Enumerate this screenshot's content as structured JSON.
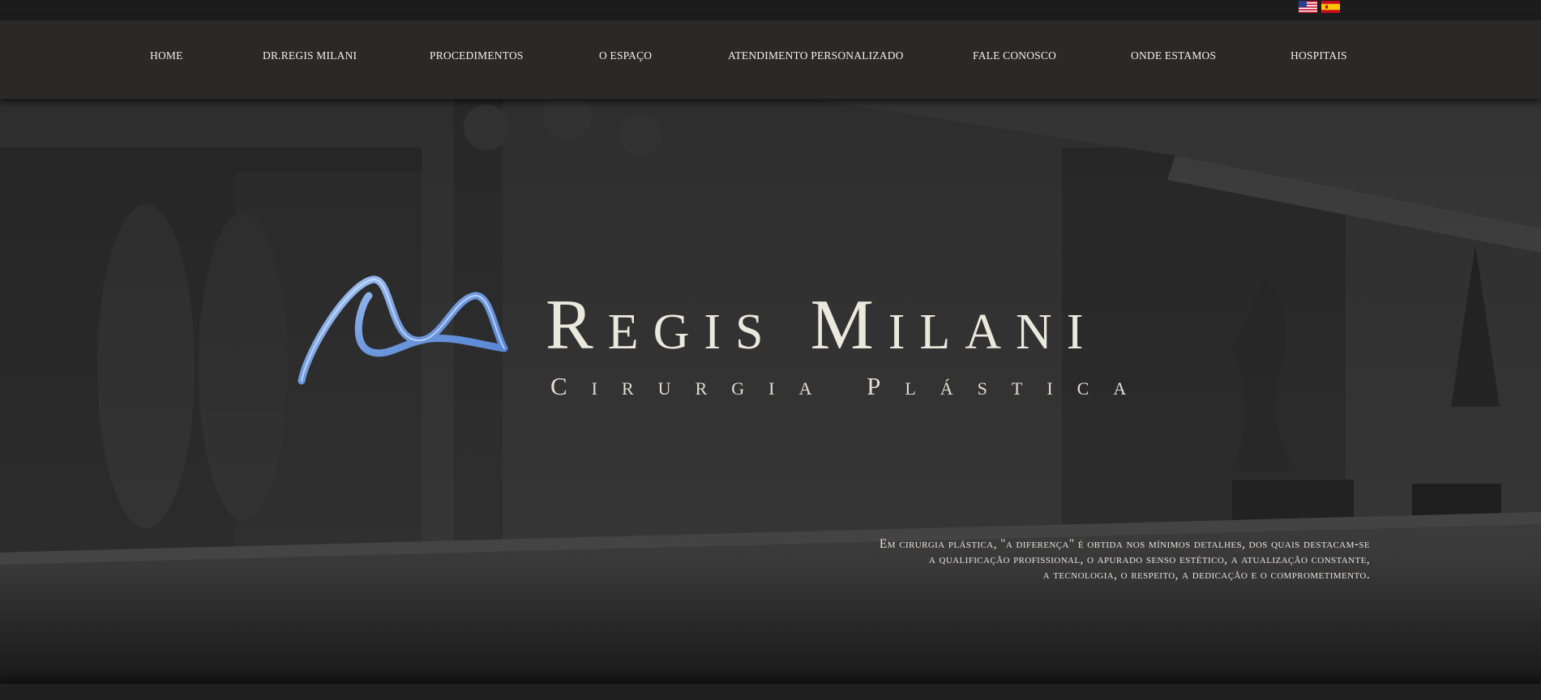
{
  "language_flags": [
    {
      "name": "English",
      "icon": "us-flag-icon"
    },
    {
      "name": "Español",
      "icon": "spain-flag-icon"
    }
  ],
  "nav": {
    "items": [
      "HOME",
      "DR.REGIS MILANI",
      "PROCEDIMENTOS",
      "O ESPAÇO",
      "ATENDIMENTO PERSONALIZADO",
      "FALE CONOSCO",
      "ONDE ESTAMOS",
      "HOSPITAIS"
    ]
  },
  "hero": {
    "brand_name": "Regis Milani",
    "brand_sub": "Cirurgia Plástica",
    "tagline": [
      "Em cirurgia plástica, \"a diferença\" é obtida nos mínimos detalhes, dos quais destacam-se",
      "a qualificação profissional, o apurado senso estético, a atualização constante,",
      "a tecnologia, o respeito, a dedicação e o comprometimento."
    ]
  },
  "colors": {
    "nav_background": "#2a2927",
    "top_bar": "#1c1c1c",
    "logo_blue": "#7aa4e6",
    "text_cream": "#ebe8dc"
  }
}
